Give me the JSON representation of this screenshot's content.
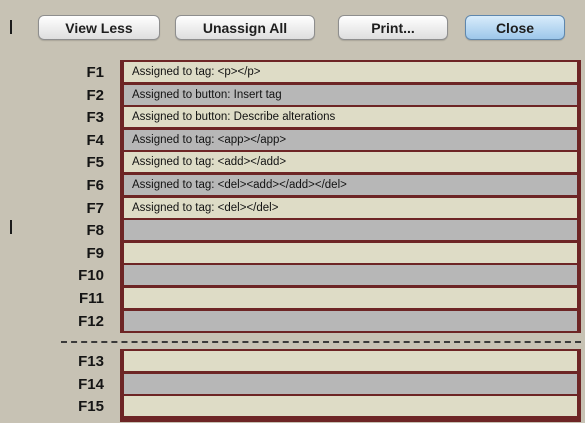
{
  "toolbar": {
    "view_less": "View Less",
    "unassign_all": "Unassign All",
    "print": "Print...",
    "close": "Close"
  },
  "group1": [
    {
      "key": "F1",
      "value": "Assigned to tag: <p></p>"
    },
    {
      "key": "F2",
      "value": "Assigned to button: Insert tag"
    },
    {
      "key": "F3",
      "value": "Assigned to button: Describe alterations"
    },
    {
      "key": "F4",
      "value": "Assigned to tag: <app></app>"
    },
    {
      "key": "F5",
      "value": "Assigned to tag: <add></add>"
    },
    {
      "key": "F6",
      "value": "Assigned to tag: <del><add></add></del>"
    },
    {
      "key": "F7",
      "value": "Assigned to tag: <del></del>"
    },
    {
      "key": "F8",
      "value": ""
    },
    {
      "key": "F9",
      "value": ""
    },
    {
      "key": "F10",
      "value": ""
    },
    {
      "key": "F11",
      "value": ""
    },
    {
      "key": "F12",
      "value": ""
    }
  ],
  "group2": [
    {
      "key": "F13",
      "value": ""
    },
    {
      "key": "F14",
      "value": ""
    },
    {
      "key": "F15",
      "value": ""
    }
  ],
  "colors": {
    "background": "#c7c2b4",
    "panel_border": "#6d2525",
    "row_light": "#dedcc6",
    "row_dark": "#b7b7b7",
    "primary_button": "#9dc7ea"
  }
}
